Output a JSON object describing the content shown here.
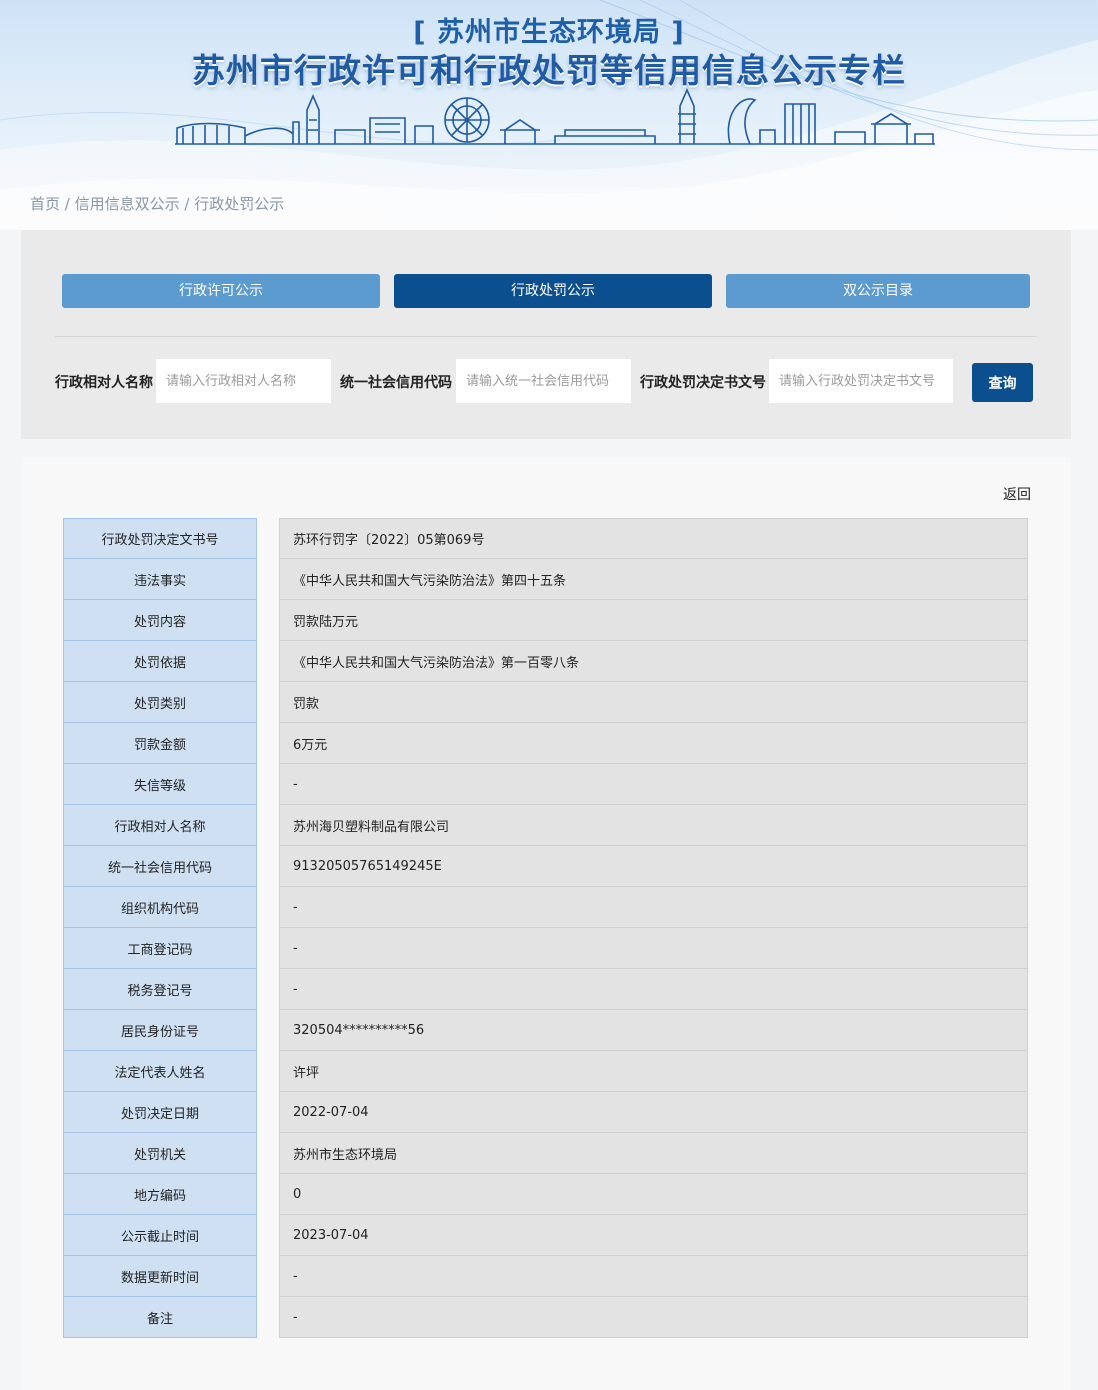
{
  "header": {
    "subtitle": "[ 苏州市生态环境局 ]",
    "title": "苏州市行政许可和行政处罚等信用信息公示专栏"
  },
  "breadcrumb": {
    "home": "首页",
    "sep": " / ",
    "level2": "信用信息双公示",
    "level3": "行政处罚公示"
  },
  "tabs": {
    "license": "行政许可公示",
    "penalty": "行政处罚公示",
    "catalog": "双公示目录"
  },
  "search": {
    "name_label": "行政相对人名称",
    "name_placeholder": "请输入行政相对人名称",
    "code_label": "统一社会信用代码",
    "code_placeholder": "请输入统一社会信用代码",
    "doc_label": "行政处罚决定书文号",
    "doc_placeholder": "请输入行政处罚决定书文号",
    "query_label": "查询"
  },
  "detail": {
    "back_label": "返回",
    "rows": [
      {
        "label": "行政处罚决定文书号",
        "value": "苏环行罚字〔2022〕05第069号"
      },
      {
        "label": "违法事实",
        "value": "《中华人民共和国大气污染防治法》第四十五条"
      },
      {
        "label": "处罚内容",
        "value": "罚款陆万元"
      },
      {
        "label": "处罚依据",
        "value": "《中华人民共和国大气污染防治法》第一百零八条"
      },
      {
        "label": "处罚类别",
        "value": "罚款"
      },
      {
        "label": "罚款金额",
        "value": "6万元"
      },
      {
        "label": "失信等级",
        "value": "-"
      },
      {
        "label": "行政相对人名称",
        "value": "苏州海贝塑料制品有限公司"
      },
      {
        "label": "统一社会信用代码",
        "value": "91320505765149245E"
      },
      {
        "label": "组织机构代码",
        "value": "-"
      },
      {
        "label": "工商登记码",
        "value": "-"
      },
      {
        "label": "税务登记号",
        "value": "-"
      },
      {
        "label": "居民身份证号",
        "value": "320504**********56"
      },
      {
        "label": "法定代表人姓名",
        "value": "许坪"
      },
      {
        "label": "处罚决定日期",
        "value": "2022-07-04"
      },
      {
        "label": "处罚机关",
        "value": "苏州市生态环境局"
      },
      {
        "label": "地方编码",
        "value": "0"
      },
      {
        "label": "公示截止时间",
        "value": "2023-07-04"
      },
      {
        "label": "数据更新时间",
        "value": "-"
      },
      {
        "label": "备注",
        "value": "-"
      }
    ]
  },
  "colors": {
    "primary": "#0c4f8f",
    "tab_light": "#5b9bd0",
    "key_cell": "#cfe0f2",
    "value_cell": "#e3e3e3"
  }
}
